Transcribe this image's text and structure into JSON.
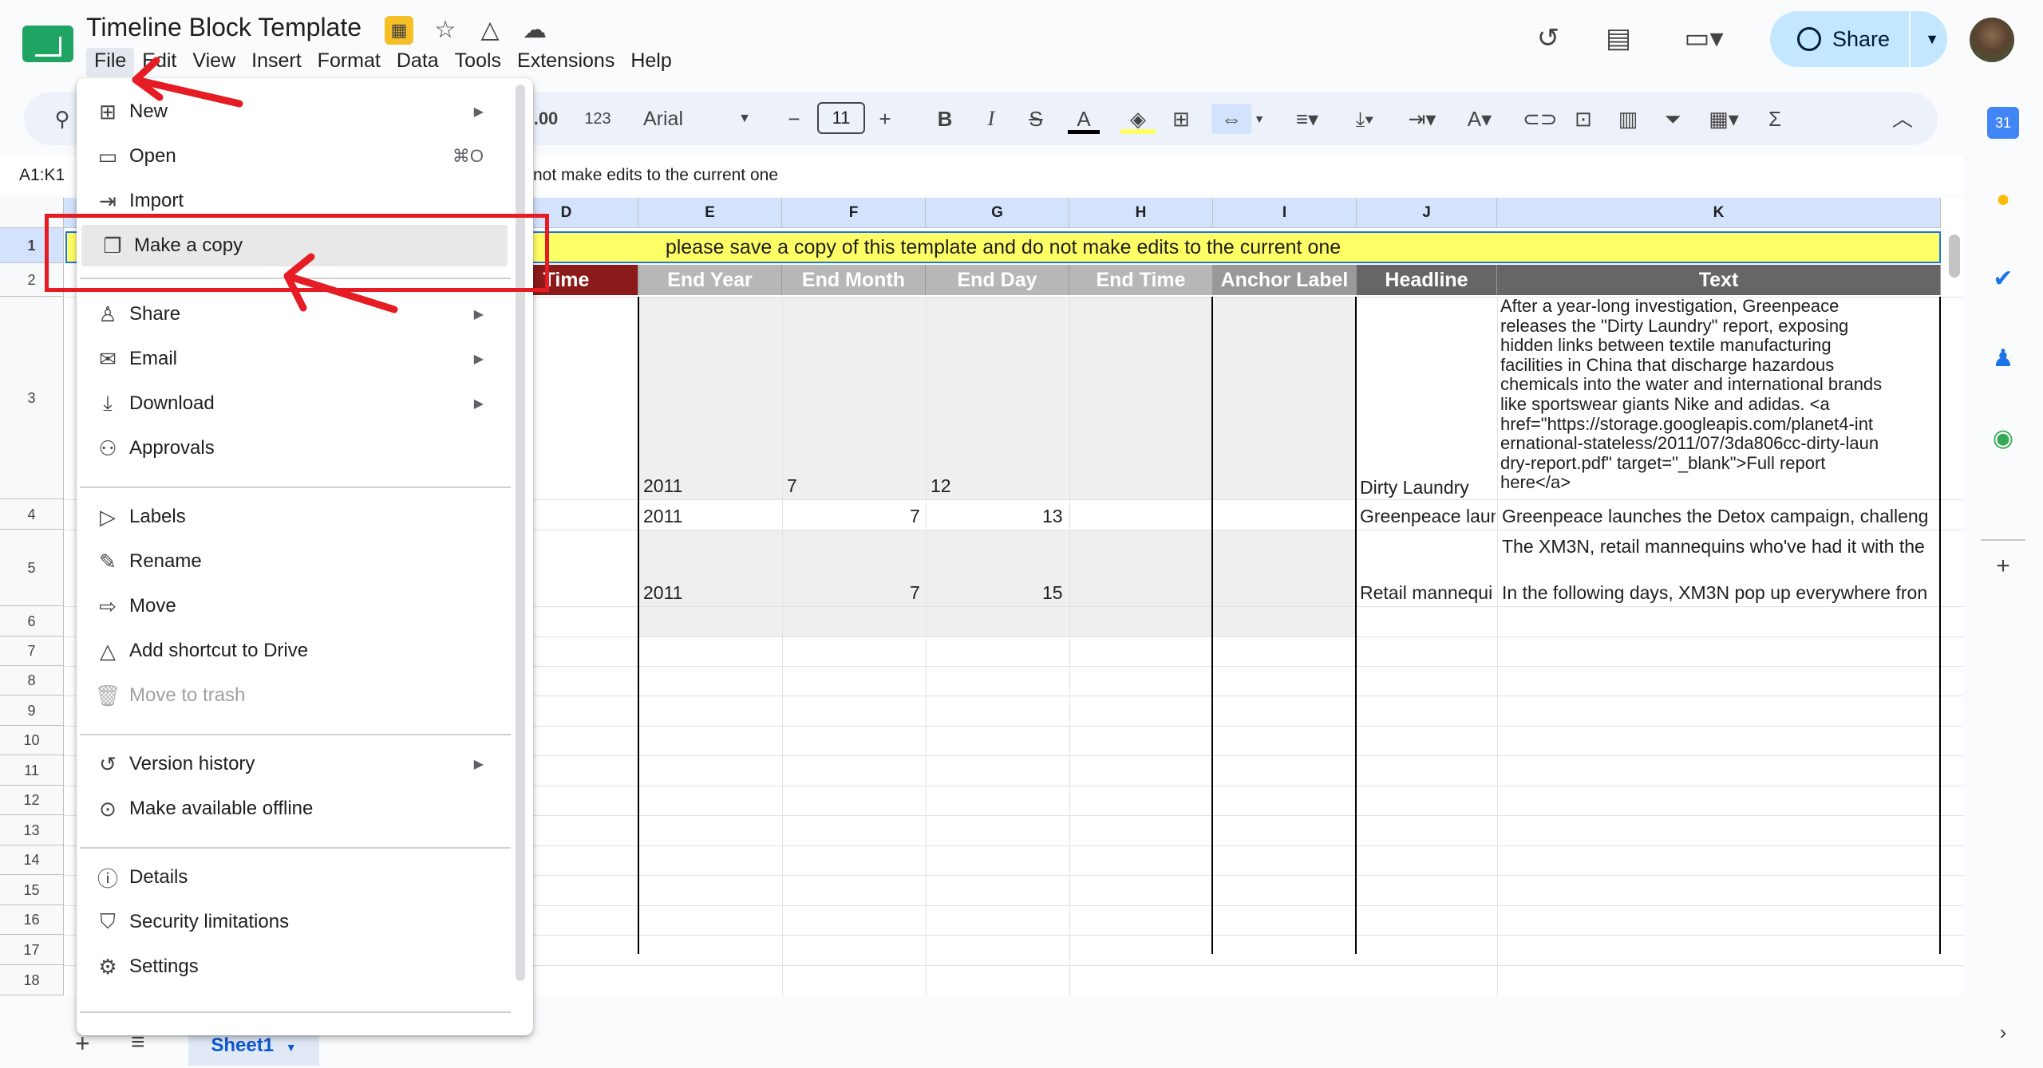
{
  "app": {
    "title": "Timeline Block Template",
    "menus": [
      "File",
      "Edit",
      "View",
      "Insert",
      "Format",
      "Data",
      "Tools",
      "Extensions",
      "Help"
    ],
    "share_label": "Share"
  },
  "toolbar": {
    "decimal_label": ".00",
    "number_format": "123",
    "font": "Arial",
    "font_size": "11"
  },
  "formula_bar": {
    "range": "A1:K1",
    "content": "not make edits to the current one"
  },
  "grid": {
    "columns": [
      "D",
      "E",
      "F",
      "G",
      "H",
      "I",
      "J",
      "K"
    ],
    "rows": [
      "1",
      "2",
      "3",
      "4",
      "5",
      "6",
      "7",
      "8",
      "9",
      "10",
      "11",
      "12",
      "13",
      "14",
      "15",
      "16",
      "17",
      "18"
    ],
    "banner": "please save a copy of this template and do not make edits to the current one",
    "headers": {
      "time": "Time",
      "end_year": "End Year",
      "end_month": "End Month",
      "end_day": "End Day",
      "end_time": "End Time",
      "anchor_label": "Anchor Label",
      "headline": "Headline",
      "text": "Text"
    },
    "row3": {
      "year": "2011",
      "month": "7",
      "day": "12",
      "headline": "Dirty Laundry",
      "text": "After a year-long investigation, Greenpeace\nreleases the \"Dirty Laundry\" report, exposing\nhidden links between textile manufacturing\nfacilities in China that discharge hazardous\nchemicals into the water and international brands\nlike sportswear giants Nike and adidas. <a\nhref=\"https://storage.googleapis.com/planet4-int\nernational-stateless/2011/07/3da806cc-dirty-laun\ndry-report.pdf\" target=\"_blank\">Full report\nhere</a>"
    },
    "row4": {
      "year": "2011",
      "month": "7",
      "day": "13",
      "headline": "Greenpeace laun",
      "text": "Greenpeace launches the Detox campaign, challeng"
    },
    "row5": {
      "year": "2011",
      "month": "7",
      "day": "15",
      "headline": "Retail mannequi",
      "text_top": "The XM3N, retail mannequins who've had it with the",
      "text": "In the following days, XM3N pop up everywhere fron"
    }
  },
  "file_menu": {
    "items": [
      {
        "label": "New",
        "icon": "sheet-plus-icon",
        "submenu": true
      },
      {
        "label": "Open",
        "icon": "folder-icon",
        "shortcut": "⌘O"
      },
      {
        "label": "Import",
        "icon": "import-icon"
      },
      {
        "label": "Make a copy",
        "icon": "copy-icon"
      },
      {
        "label": "Share",
        "icon": "person-add-icon",
        "submenu": true
      },
      {
        "label": "Email",
        "icon": "mail-icon",
        "submenu": true
      },
      {
        "label": "Download",
        "icon": "download-icon",
        "submenu": true
      },
      {
        "label": "Approvals",
        "icon": "approval-icon"
      },
      {
        "label": "Labels",
        "icon": "label-icon"
      },
      {
        "label": "Rename",
        "icon": "pencil-icon"
      },
      {
        "label": "Move",
        "icon": "move-folder-icon"
      },
      {
        "label": "Add shortcut to Drive",
        "icon": "drive-shortcut-icon"
      },
      {
        "label": "Move to trash",
        "icon": "trash-icon",
        "disabled": true
      },
      {
        "label": "Version history",
        "icon": "history-icon",
        "submenu": true
      },
      {
        "label": "Make available offline",
        "icon": "offline-icon"
      },
      {
        "label": "Details",
        "icon": "info-icon"
      },
      {
        "label": "Security limitations",
        "icon": "shield-icon"
      },
      {
        "label": "Settings",
        "icon": "gear-icon"
      }
    ]
  },
  "sheets": {
    "active": "Sheet1"
  },
  "colors": {
    "accent": "#1a73e8",
    "share_bg": "#c2e7ff",
    "banner": "#ffff66",
    "header_dark_red": "#8b1a1a",
    "header_grey": "#b7b7b7",
    "header_dark_grey": "#666666",
    "annotation_red": "#e51c23"
  }
}
